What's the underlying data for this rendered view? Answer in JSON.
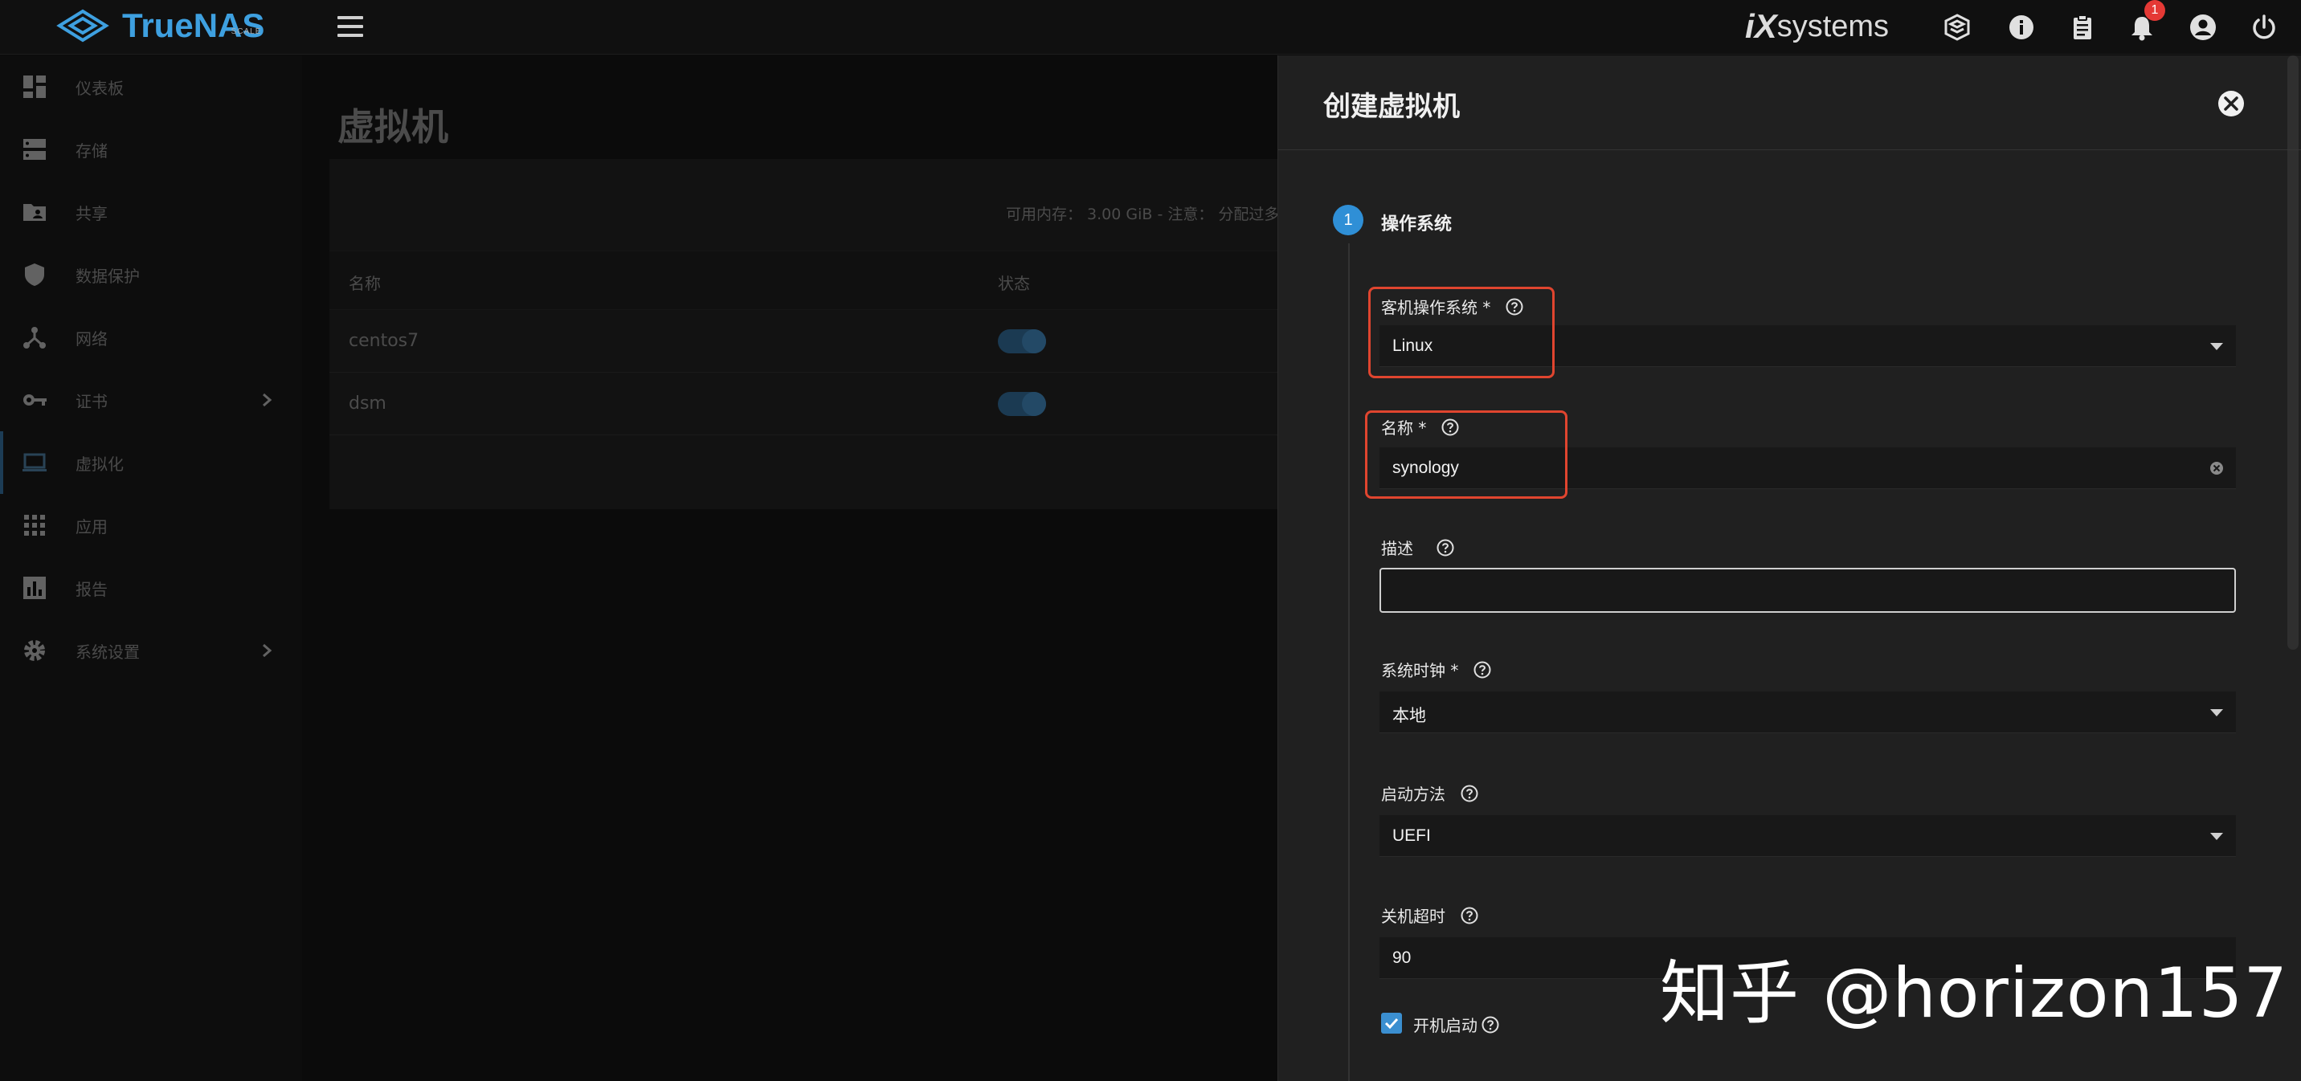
{
  "app": {
    "logo_text": "TrueNAS",
    "logo_sub": "SCALE",
    "vendor_logo_ix": "iX",
    "vendor_logo_systems": "systems",
    "notification_count": "1"
  },
  "sidebar": {
    "items": [
      {
        "label": "仪表板",
        "icon": "dashboard-icon"
      },
      {
        "label": "存储",
        "icon": "storage-icon"
      },
      {
        "label": "共享",
        "icon": "folder-share-icon"
      },
      {
        "label": "数据保护",
        "icon": "shield-icon"
      },
      {
        "label": "网络",
        "icon": "network-icon"
      },
      {
        "label": "证书",
        "icon": "key-icon"
      },
      {
        "label": "虚拟化",
        "icon": "laptop-icon"
      },
      {
        "label": "应用",
        "icon": "apps-grid-icon"
      },
      {
        "label": "报告",
        "icon": "bar-chart-icon"
      },
      {
        "label": "系统设置",
        "icon": "gear-icon"
      }
    ]
  },
  "main": {
    "title": "虚拟机",
    "memory_line": "可用内存： 3.00 GiB - 注意： 分配过多",
    "columns": [
      "名称",
      "状态"
    ],
    "rows": [
      {
        "name": "centos7"
      },
      {
        "name": "dsm"
      }
    ]
  },
  "panel": {
    "title": "创建虚拟机",
    "step_number": "1",
    "step_label": "操作系统",
    "fields": {
      "guest_os": {
        "label": "客机操作系统 *",
        "value": "Linux"
      },
      "name": {
        "label": "名称 *",
        "value": "synology"
      },
      "description": {
        "label": "描述",
        "value": ""
      },
      "system_clock": {
        "label": "系统时钟 *",
        "value": "本地"
      },
      "boot_method": {
        "label": "启动方法",
        "value": "UEFI"
      },
      "shutdown_timeout": {
        "label": "关机超时",
        "value": "90"
      },
      "start_on_boot": {
        "label": "开机启动",
        "checked": true
      }
    }
  },
  "watermark": "知乎 @horizon157",
  "colors": {
    "accent": "#2f8fd6",
    "highlight": "#e0452f",
    "logo": "#3ea0e0"
  }
}
